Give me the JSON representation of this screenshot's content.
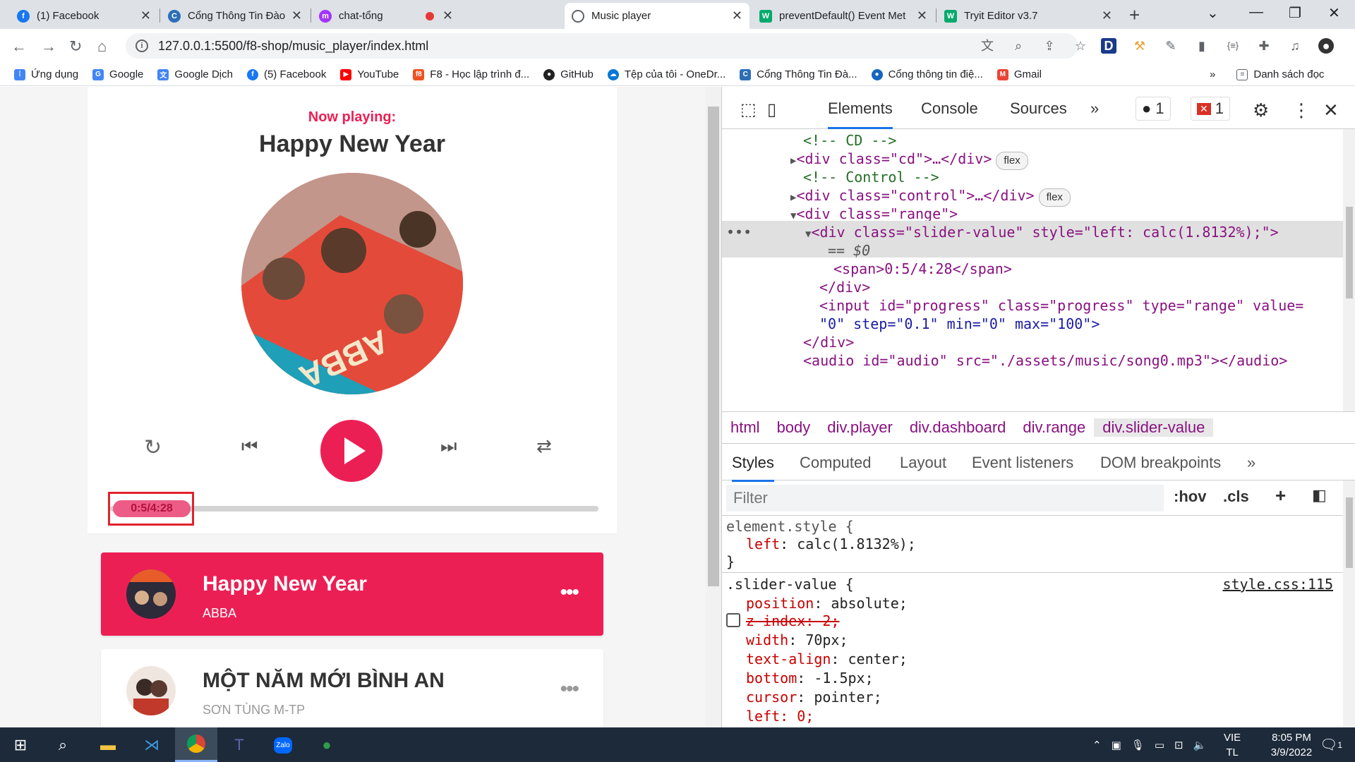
{
  "tabs": [
    {
      "title": "(1) Facebook",
      "icon": "facebook-icon",
      "color": "#1877f2"
    },
    {
      "title": "Cổng Thông Tin Đào Tạo-Tr",
      "icon": "university-icon",
      "color": "#2c6fb7"
    },
    {
      "title": "chat-tổng",
      "icon": "messenger-icon",
      "color": "#a334fa"
    },
    {
      "title": "Music player",
      "icon": "globe-icon",
      "color": "#5f6368"
    },
    {
      "title": "preventDefault() Event Met",
      "icon": "w3schools-icon",
      "color": "#04aa6d"
    },
    {
      "title": "Tryit Editor v3.7",
      "icon": "w3schools-icon",
      "color": "#04aa6d"
    }
  ],
  "address": "127.0.0.1:5500/f8-shop/music_player/index.html",
  "bookmarks": [
    {
      "label": "Ứng dụng"
    },
    {
      "label": "Google"
    },
    {
      "label": "Google Dịch"
    },
    {
      "label": "(5) Facebook"
    },
    {
      "label": "YouTube"
    },
    {
      "label": "F8 - Học lập trình đ..."
    },
    {
      "label": "GitHub"
    },
    {
      "label": "Tệp của tôi - OneDr..."
    },
    {
      "label": "Cổng Thông Tin Đà..."
    },
    {
      "label": "Cổng thông tin điệ..."
    },
    {
      "label": "Gmail"
    }
  ],
  "bookmarks_more": "»",
  "reading_list": "Danh sách đọc",
  "player": {
    "now_playing": "Now playing:",
    "title": "Happy New Year",
    "time": "0:5/4:28",
    "progress_percent": 1.8132
  },
  "playlist": [
    {
      "title": "Happy New Year",
      "author": "ABBA",
      "active": true
    },
    {
      "title": "MỘT NĂM MỚI BÌNH AN",
      "author": "SƠN TÙNG M-TP",
      "active": false
    }
  ],
  "more_dots": "•••",
  "devtools": {
    "tabs": [
      "Elements",
      "Console",
      "Sources"
    ],
    "more": "»",
    "issues_count": "1",
    "errors_count": "1",
    "elements": {
      "l1": "<!-- CD -->",
      "l2_tag": "<div class=\"cd\">…</div>",
      "flex": "flex",
      "l3": "<!-- Control -->",
      "l4_tag": "<div class=\"control\">…</div>",
      "l5": "<div class=\"range\">",
      "l6": "<div class=\"slider-value\" style=\"left: calc(1.8132%);\">",
      "l7": "== $0",
      "l8": "<span>0:5/4:28</span>",
      "l9": "</div>",
      "l10": "<input id=\"progress\" class=\"progress\" type=\"range\" value=",
      "l11": "\"0\" step=\"0.1\" min=\"0\" max=\"100\">",
      "l12": "</div>",
      "l13": "<audio id=\"audio\" src=\"./assets/music/song0.mp3\"></audio>",
      "dots": "•••"
    },
    "breadcrumbs": [
      "html",
      "body",
      "div.player",
      "div.dashboard",
      "div.range",
      "div.slider-value"
    ],
    "style_tabs": [
      "Styles",
      "Computed",
      "Layout",
      "Event listeners",
      "DOM breakpoints"
    ],
    "style_more": "»",
    "filter_placeholder": "Filter",
    "hov": ":hov",
    "cls": ".cls",
    "plus": "+",
    "styles": {
      "s1": "element.style {",
      "s2p": "left",
      "s2v": "calc(1.8132%);",
      "s3": "}",
      "s4": ".slider-value {",
      "src": "style.css:115",
      "p1": "position",
      "v1": "absolute;",
      "p2": "z-index: 2;",
      "p3": "width",
      "v3": "70px;",
      "p4": "text-align",
      "v4": "center;",
      "p5": "bottom",
      "v5": "-1.5px;",
      "p6": "cursor",
      "v6": "pointer;",
      "p7": "left: 0;"
    }
  },
  "taskbar": {
    "lang1": "VIE",
    "lang2": "TL",
    "time": "8:05 PM",
    "date": "3/9/2022",
    "notif": "1"
  }
}
